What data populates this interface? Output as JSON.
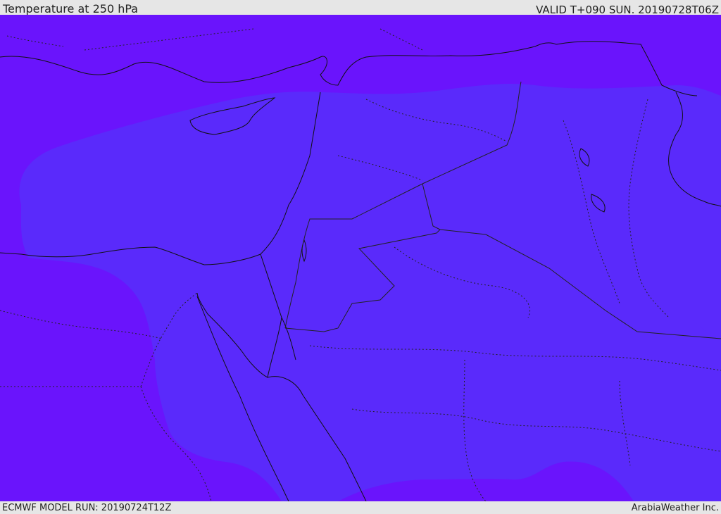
{
  "header": {
    "title": "Temperature at 250 hPa",
    "valid": "VALID T+090 SUN. 20190728T06Z"
  },
  "footer": {
    "model_run": "ECMWF MODEL RUN: 20190724T12Z",
    "credit": "ArabiaWeather Inc."
  },
  "map": {
    "field": "Temperature at 250 hPa",
    "colors": {
      "warm_band": "#6a14fc",
      "cool_band": "#5a2afb",
      "coastline": "#111111",
      "border": "#222222"
    }
  }
}
